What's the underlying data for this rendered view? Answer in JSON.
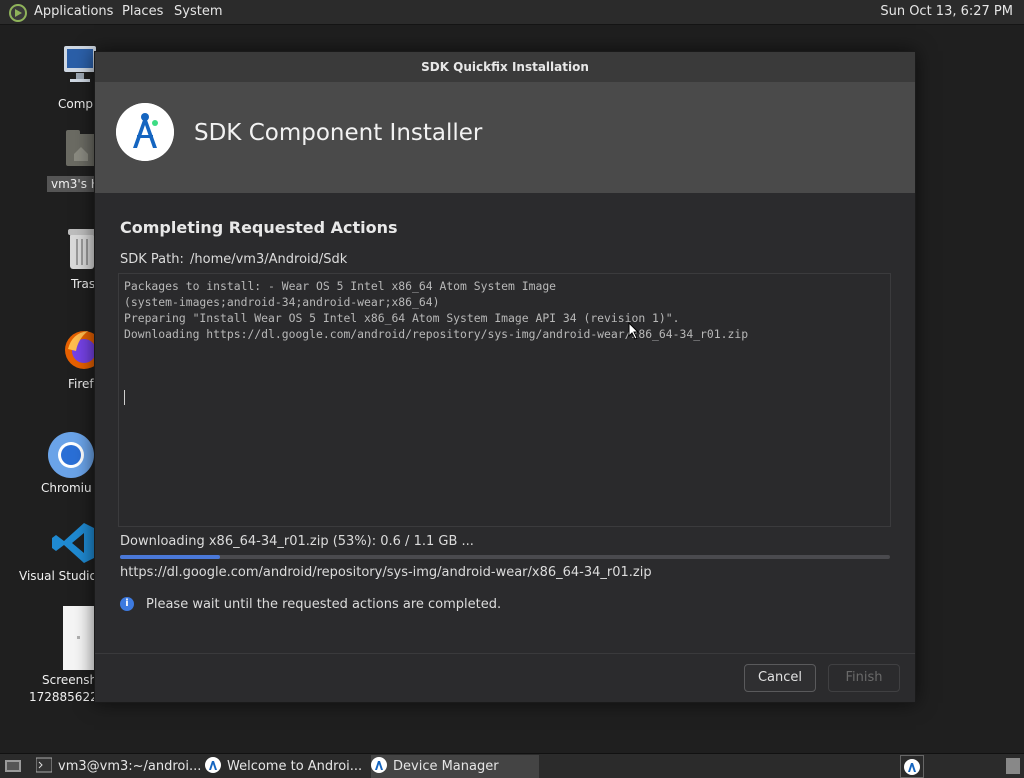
{
  "top_panel": {
    "menus": [
      "Applications",
      "Places",
      "System"
    ],
    "clock": "Sun Oct 13,  6:27 PM"
  },
  "desktop": {
    "icons": [
      {
        "label": "Comp",
        "icon": "computer-icon"
      },
      {
        "label": "vm3's H",
        "icon": "home-folder-icon"
      },
      {
        "label": "Tras",
        "icon": "trash-icon"
      },
      {
        "label": "Firef",
        "icon": "firefox-icon"
      },
      {
        "label": "Chromiu",
        "icon": "chromium-icon"
      },
      {
        "label": "Visual Studio",
        "icon": "vscode-icon"
      },
      {
        "label": "Screensh",
        "label2": "172885622",
        "icon": "screenshot-file-icon"
      }
    ]
  },
  "dialog": {
    "window_title": "SDK Quickfix Installation",
    "header_title": "SDK Component Installer",
    "section_title": "Completing Requested Actions",
    "sdk_path_label": "SDK Path:",
    "sdk_path_value": "/home/vm3/Android/Sdk",
    "log_lines": [
      "Packages to install: - Wear OS 5 Intel x86_64 Atom System Image",
      "(system-images;android-34;android-wear;x86_64)",
      "",
      "",
      "Preparing \"Install Wear OS 5 Intel x86_64 Atom System Image API 34 (revision 1)\".",
      "Downloading https://dl.google.com/android/repository/sys-img/android-wear/x86_64-34_r01.zip"
    ],
    "download_status": "Downloading x86_64-34_r01.zip (53%): 0.6 / 1.1 GB ...",
    "download_progress": 0.13,
    "download_url": "https://dl.google.com/android/repository/sys-img/android-wear/x86_64-34_r01.zip",
    "info_text": "Please wait until the requested actions are completed.",
    "cancel_label": "Cancel",
    "finish_label": "Finish",
    "accent_color": "#4a78d8"
  },
  "taskbar": {
    "items": [
      {
        "label": "vm3@vm3:~/androi...",
        "icon": "terminal-icon"
      },
      {
        "label": "Welcome to Androi...",
        "icon": "android-studio-icon"
      },
      {
        "label": "Device Manager",
        "icon": "android-studio-icon"
      }
    ]
  }
}
